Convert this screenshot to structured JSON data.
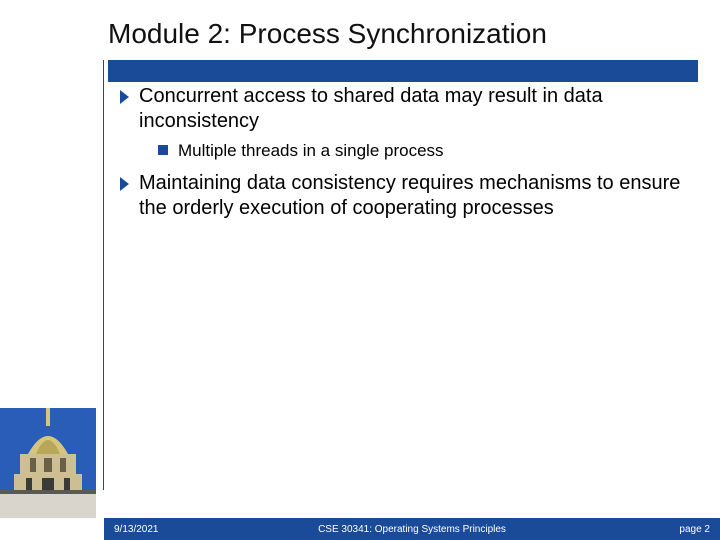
{
  "title": "Module 2: Process Synchronization",
  "bullets": [
    {
      "text": "Concurrent access to shared data may result in data inconsistency",
      "subs": [
        "Multiple threads in a single process"
      ]
    },
    {
      "text": "Maintaining data consistency requires mechanisms to ensure the orderly execution of cooperating processes",
      "subs": []
    }
  ],
  "footer": {
    "date": "9/13/2021",
    "course": "CSE 30341: Operating Systems Principles",
    "page": "page 2"
  }
}
